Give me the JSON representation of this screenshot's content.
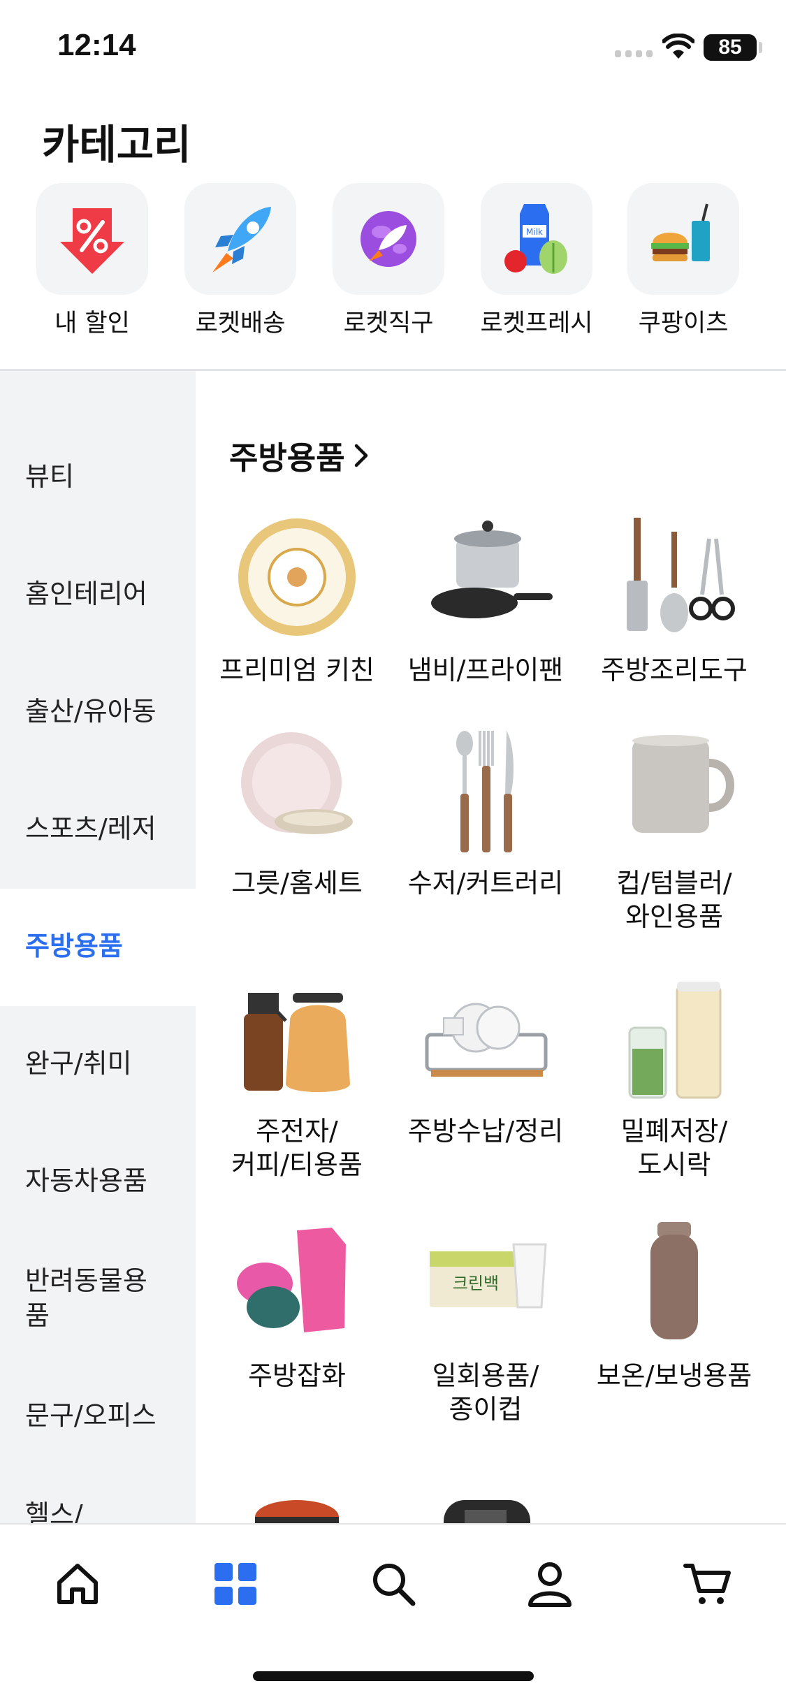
{
  "status": {
    "time": "12:14",
    "battery": "85"
  },
  "header": {
    "title": "카테고리"
  },
  "quick": [
    {
      "label": "내 할인",
      "icon": "discount-tag-icon"
    },
    {
      "label": "로켓배송",
      "icon": "rocket-icon"
    },
    {
      "label": "로켓직구",
      "icon": "purple-rocket-globe-icon"
    },
    {
      "label": "로켓프레시",
      "icon": "milk-produce-icon"
    },
    {
      "label": "쿠팡이츠",
      "icon": "burger-drink-icon"
    }
  ],
  "sidebar": {
    "items": [
      "뷰티",
      "홈인테리어",
      "출산/유아동",
      "스포츠/레저",
      "주방용품",
      "완구/취미",
      "자동차용품",
      "반려동물용",
      "품",
      "문구/오피스",
      "헬스/"
    ],
    "active": "주방용품"
  },
  "main": {
    "section_title": "주방용품",
    "grid": [
      {
        "line1": "프리미엄 키친",
        "line2": "",
        "icon": "decorative-plate-icon"
      },
      {
        "line1": "냄비/프라이팬",
        "line2": "",
        "icon": "pot-and-pan-icon"
      },
      {
        "line1": "주방조리도구",
        "line2": "",
        "icon": "cooking-utensils-icon"
      },
      {
        "line1": "그릇/홈세트",
        "line2": "",
        "icon": "dish-set-icon"
      },
      {
        "line1": "수저/커트러리",
        "line2": "",
        "icon": "cutlery-icon"
      },
      {
        "line1": "컵/텀블러/",
        "line2": "와인용품",
        "icon": "mug-icon"
      },
      {
        "line1": "주전자/",
        "line2": "커피/티용품",
        "icon": "kettle-coffee-icon"
      },
      {
        "line1": "주방수납/정리",
        "line2": "",
        "icon": "dish-rack-icon"
      },
      {
        "line1": "밀폐저장/",
        "line2": "도시락",
        "icon": "storage-jar-icon"
      },
      {
        "line1": "주방잡화",
        "line2": "",
        "icon": "gloves-sponge-icon"
      },
      {
        "line1": "일회용품/",
        "line2": "종이컵",
        "icon": "paper-cup-icon"
      },
      {
        "line1": "보온/보냉용품",
        "line2": "",
        "icon": "thermos-bottle-icon"
      }
    ]
  },
  "tabbar": [
    {
      "name": "home-icon"
    },
    {
      "name": "category-grid-icon",
      "active": true
    },
    {
      "name": "search-icon"
    },
    {
      "name": "profile-icon"
    },
    {
      "name": "cart-icon"
    }
  ],
  "colors": {
    "accent": "#2b6ff0",
    "sidebar_bg": "#f2f3f5",
    "tile_bg": "#f3f4f6"
  }
}
